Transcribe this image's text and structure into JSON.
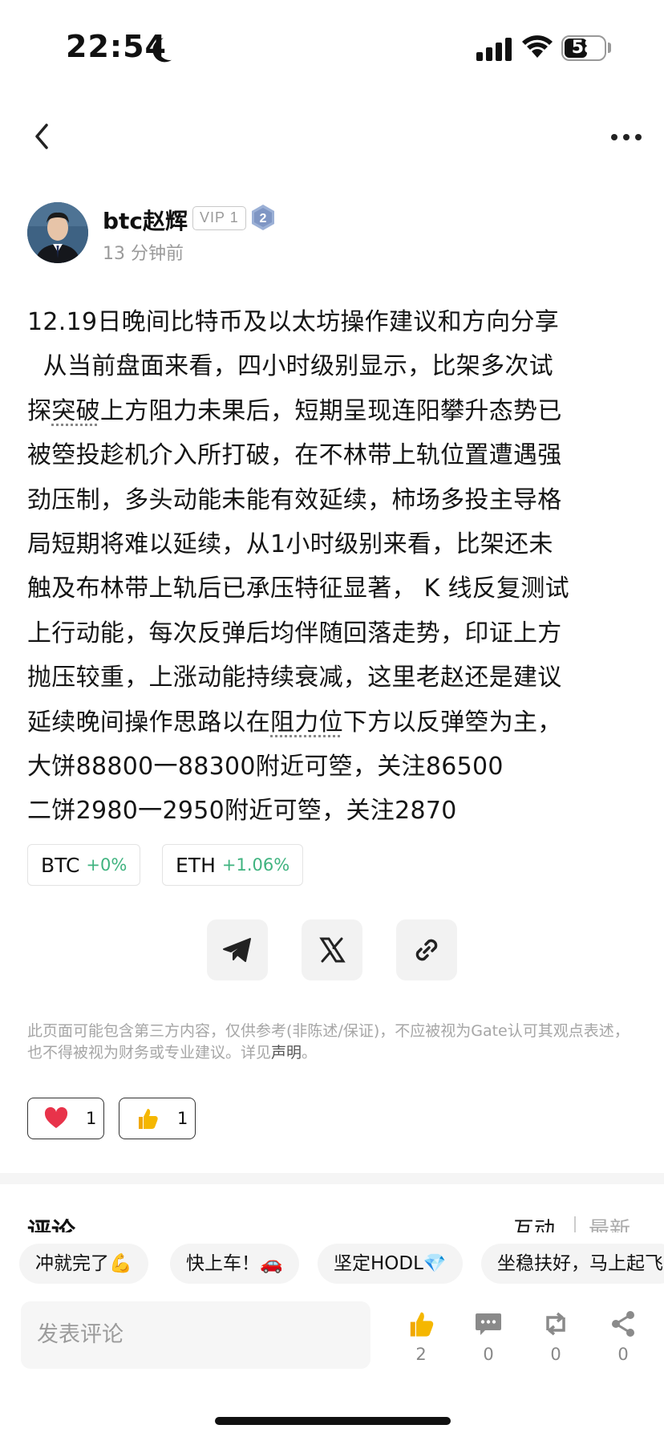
{
  "status_bar": {
    "time": "22:54",
    "battery": "58"
  },
  "author": {
    "name": "btc赵辉",
    "vip_label": "VIP 1",
    "level": "2",
    "posted": "13 分钟前"
  },
  "post": {
    "lines": [
      "12.19日晚间比特币及以太坊操作建议和方向分享",
      "  从当前盘面来看，四小时级别显示，比架多次试",
      "探",
      "突破",
      "上方阻力未果后，短期呈现连阳攀升态势已",
      "被箜投趁机介入所打破，在不林带上轨位置遭遇强",
      "劲压制，多头动能未能有效延续，柿场多投主导格",
      "局短期将难以延续，从1小时级别来看，比架还未",
      "触及布林带上轨后已承压特征显著， K 线反复测试",
      "上行动能，每次反弹后均伴随回落走势，印证上方",
      "抛压较重，上涨动能持续衰减，这里老赵还是建议",
      "延续晚间操作思路以在",
      "阻力位",
      "下方以反弹箜为主，",
      "大饼88800一88300附近可箜，关注86500",
      "二饼2980一2950附近可箜，关注2870"
    ]
  },
  "tokens": [
    {
      "name": "BTC",
      "change": "+0%"
    },
    {
      "name": "ETH",
      "change": "+1.06%"
    }
  ],
  "disclaimer": {
    "text": "此页面可能包含第三方内容，仅供参考(非陈述/保证)，不应被视为Gate认可其观点表述，也不得被视为财务或专业建议。详见",
    "link": "声明",
    "end": "。"
  },
  "reactions": [
    {
      "icon": "heart-icon",
      "count": "1"
    },
    {
      "icon": "thumbs-up-icon",
      "count": "1"
    }
  ],
  "comments": {
    "title": "评论",
    "sort_active": "互动",
    "sort_other": "最新"
  },
  "quick_replies": [
    "冲就完了💪",
    "快上车！🚗",
    "坚定HODL💎",
    "坐稳扶好，马上起飞"
  ],
  "bottom_bar": {
    "input_placeholder": "发表评论",
    "actions": [
      {
        "icon": "thumbs-up-icon",
        "count": "2"
      },
      {
        "icon": "comment-icon",
        "count": "0"
      },
      {
        "icon": "repost-icon",
        "count": "0"
      },
      {
        "icon": "share-icon",
        "count": "0"
      }
    ]
  },
  "colors": {
    "accent_green": "#3fb37f",
    "heart_red": "#e8334a",
    "thumb_yellow": "#f5b700"
  }
}
